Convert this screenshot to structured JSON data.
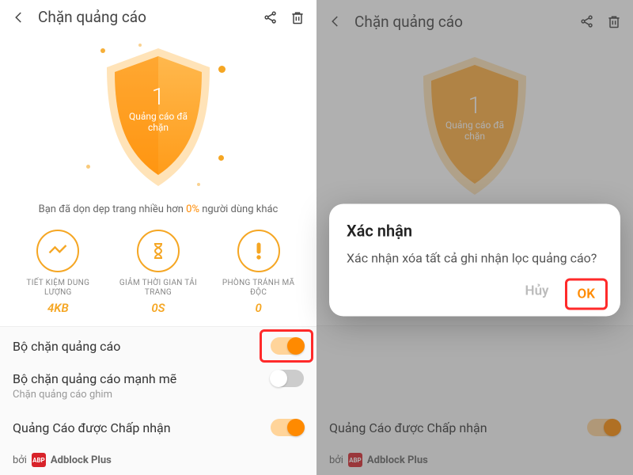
{
  "header": {
    "title": "Chặn quảng cáo"
  },
  "shield": {
    "count": "1",
    "label_l1": "Quảng cáo đã",
    "label_l2": "chặn"
  },
  "clean_line_pre": "Bạn đã dọn dẹp trang nhiều hơn ",
  "clean_line_pct": "0%",
  "clean_line_post": " người dùng khác",
  "metrics": [
    {
      "label": "TIẾT KIỆM DUNG LƯỢNG",
      "value": "4KB"
    },
    {
      "label": "GIẢM THỜI GIAN TẢI TRANG",
      "value": "0S"
    },
    {
      "label": "PHÒNG TRÁNH MÃ ĐỘC",
      "value": "0"
    }
  ],
  "rows": {
    "blocker": "Bộ chặn quảng cáo",
    "strong": "Bộ chặn quảng cáo mạnh mẽ",
    "strong_sub": "Chặn quảng cáo ghim",
    "acceptable": "Quảng Cáo được Chấp nhận"
  },
  "footer": {
    "prefix": "bởi",
    "brand": "ABP",
    "name": "Adblock Plus"
  },
  "dialog": {
    "title": "Xác nhận",
    "body": "Xác nhận xóa tất cả ghi nhận lọc quảng cáo?",
    "cancel": "Hủy",
    "ok": "OK"
  }
}
